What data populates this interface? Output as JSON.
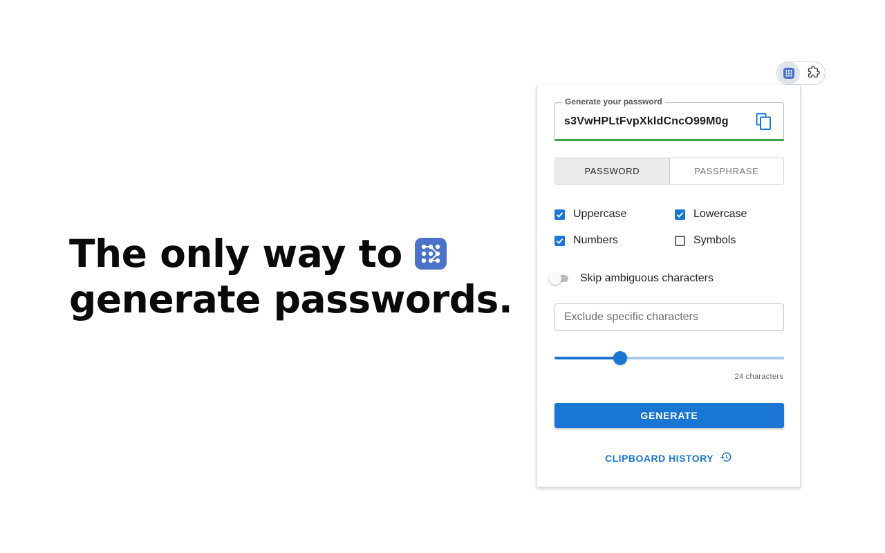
{
  "hero": {
    "line1": "The only way to",
    "line2": "generate passwords."
  },
  "toolbar": {
    "extension_icon": "dot-grid-logo-icon",
    "extensions_icon": "puzzle-icon"
  },
  "popup": {
    "password_field": {
      "label": "Generate your password",
      "value": "s3VwHPLtFvpXkldCncO99M0g",
      "copy_icon": "copy-icon",
      "strength_color": "#3fa34d"
    },
    "tabs": [
      {
        "label": "PASSWORD",
        "selected": true
      },
      {
        "label": "PASSPHRASE",
        "selected": false
      }
    ],
    "options": {
      "uppercase": {
        "label": "Uppercase",
        "checked": true
      },
      "lowercase": {
        "label": "Lowercase",
        "checked": true
      },
      "numbers": {
        "label": "Numbers",
        "checked": true
      },
      "symbols": {
        "label": "Symbols",
        "checked": false
      }
    },
    "skip_ambiguous": {
      "label": "Skip ambiguous characters",
      "enabled": false
    },
    "exclude": {
      "placeholder": "Exclude specific characters",
      "value": ""
    },
    "length": {
      "value": 24,
      "min": 8,
      "max": 64,
      "label": "24 characters"
    },
    "generate_label": "GENERATE",
    "history_label": "CLIPBOARD HISTORY",
    "history_icon": "history-icon"
  },
  "colors": {
    "accent": "#1976d2",
    "logo": "#4a72c9",
    "strength": "#3fa34d"
  }
}
